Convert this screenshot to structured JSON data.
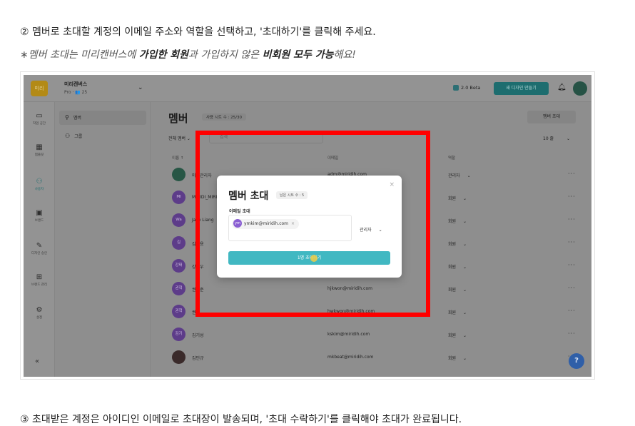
{
  "instructions": {
    "step2": "② 멤버로 초대할 계정의 이메일 주소와 역할을 선택하고, '초대하기'를 클릭해 주세요.",
    "note_prefix": "∗멤버 초대는 미리캔버스에 ",
    "note_bold1": "가입한 회원",
    "note_mid": "과 가입하지 않은 ",
    "note_bold2": "비회원 모두 가능",
    "note_suffix": "해요!",
    "step3": "③ 초대받은 계정은 아이디인 이메일로 초대장이 발송되며, '초대 수락하기'를 클릭해야 초대가 완료됩니다."
  },
  "topbar": {
    "logo_text": "미리",
    "workspace_name": "미리캔버스",
    "workspace_sub": "Pro · 👥 25",
    "beta_label": "2.0 Beta",
    "new_design_label": "새 디자인 만들기"
  },
  "rail": [
    {
      "icon": "▭",
      "label": "작업 공간"
    },
    {
      "icon": "▦",
      "label": "템플릿"
    },
    {
      "icon": "⚇",
      "label": "사용자"
    },
    {
      "icon": "▣",
      "label": "브랜드"
    },
    {
      "icon": "✎",
      "label": "디자인 승인"
    },
    {
      "icon": "⊞",
      "label": "브랜드 관리"
    },
    {
      "icon": "⚙",
      "label": "설정"
    }
  ],
  "rail_collapse": "«",
  "subnav": {
    "members": "멤버",
    "groups": "그룹"
  },
  "main": {
    "title": "멤버",
    "seat_badge": "사용 시트 수 : 25/30",
    "invite_button": "멤버 초대",
    "filter_label": "전체 멤버",
    "search_placeholder": "검색",
    "per_page": "10 줄",
    "col_name": "이름 ↑",
    "col_email": "이메일",
    "col_role": "역할"
  },
  "rows": [
    {
      "initials": "",
      "name": "미리관리자",
      "email": "adm@miridih.com",
      "role": "관리자",
      "avatar_color": "#275645"
    },
    {
      "initials": "MI",
      "name": "MIRIDI_MIRI",
      "email": "",
      "role": "회원",
      "avatar_color": "#5d3c89"
    },
    {
      "initials": "Wa",
      "name": "Jake Liang",
      "email": "",
      "role": "회원",
      "avatar_color": "#5d3c89"
    },
    {
      "initials": "김",
      "name": "김정용",
      "email": "",
      "role": "회원",
      "avatar_color": "#5d3c89"
    },
    {
      "initials": "강태",
      "name": "강태우",
      "email": "",
      "role": "회원",
      "avatar_color": "#5d3c89"
    },
    {
      "initials": "권혁",
      "name": "권혁준",
      "email": "hjkwon@miridih.com",
      "role": "회원",
      "avatar_color": "#5d3c89"
    },
    {
      "initials": "권혁",
      "name": "권혁",
      "email": "hwkwon@miridih.com",
      "role": "회원",
      "avatar_color": "#5d3c89"
    },
    {
      "initials": "김기",
      "name": "김기성",
      "email": "kskim@miridih.com",
      "role": "회원",
      "avatar_color": "#5d3c89"
    },
    {
      "initials": "",
      "name": "김민규",
      "email": "mkbeat@miridih.com",
      "role": "회원",
      "avatar_color": "#3a2a2a"
    }
  ],
  "modal": {
    "title": "멤버 초대",
    "seats": "남은 시트 수 : 5",
    "email_label": "이메일 초대",
    "chip_initials": "ym",
    "chip_email": "ymkim@miridih.com",
    "chip_remove": "×",
    "role_value": "관리자",
    "submit_label": "1명 초대하기",
    "close": "×"
  },
  "help_label": "?"
}
